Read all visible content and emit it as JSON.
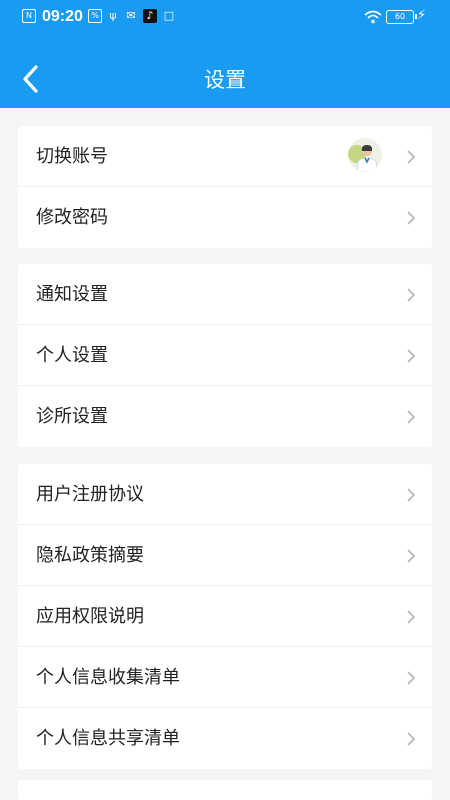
{
  "status_bar": {
    "time": "09:20",
    "battery": "60"
  },
  "header": {
    "title": "设置"
  },
  "groups": [
    {
      "items": [
        {
          "label": "切换账号",
          "has_avatar": true
        },
        {
          "label": "修改密码"
        }
      ]
    },
    {
      "items": [
        {
          "label": "通知设置"
        },
        {
          "label": "个人设置"
        },
        {
          "label": "诊所设置"
        }
      ]
    },
    {
      "items": [
        {
          "label": "用户注册协议"
        },
        {
          "label": "隐私政策摘要"
        },
        {
          "label": "应用权限说明"
        },
        {
          "label": "个人信息收集清单"
        },
        {
          "label": "个人信息共享清单"
        }
      ]
    }
  ],
  "colors": {
    "accent": "#1a9bf2",
    "background": "#f4f5f7",
    "chevron": "#b5b8bd"
  }
}
